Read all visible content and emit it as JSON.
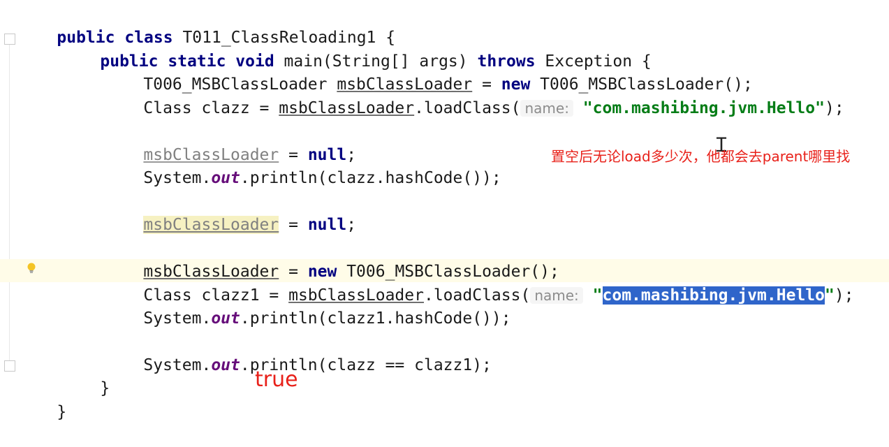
{
  "editor": {
    "code": {
      "l1_kw1": "public",
      "l1_kw2": "class",
      "l1_name": " T011_ClassReloading1 {",
      "l2_kw1": "public",
      "l2_kw2": "static",
      "l2_kw3": "void",
      "l2_mid": " main(String[] args) ",
      "l2_kw4": "throws",
      "l2_end": " Exception {",
      "l3_type": "T006_MSBClassLoader ",
      "l3_var": "msbClassLoader",
      "l3_eq": " = ",
      "l3_kw": "new",
      "l3_end": " T006_MSBClassLoader();",
      "l4_a": "Class clazz = ",
      "l4_var": "msbClassLoader",
      "l4_call": ".loadClass(",
      "l4_hint": "name:",
      "l4_str": "\"com.mashibing.jvm.Hello\"",
      "l4_end": ");",
      "l5_var": "msbClassLoader",
      "l5_eq": " = ",
      "l5_kw": "null",
      "l5_end": ";",
      "l6_a": "System.",
      "l6_field": "out",
      "l6_b": ".println(clazz.hashCode());",
      "l7_var": "msbClassLoader",
      "l7_eq": " = ",
      "l7_kw": "null",
      "l7_end": ";",
      "l8_var": "msbClassLoader",
      "l8_eq": " = ",
      "l8_kw": "new",
      "l8_end": " T006_MSBClassLoader();",
      "l9_a": "Class clazz1 = ",
      "l9_var": "msbClassLoader",
      "l9_call": ".loadClass(",
      "l9_hint": "name:",
      "l9_q1": "\"",
      "l9_sel": "com.mashibing.jvm.Hello",
      "l9_q2": "\"",
      "l9_end": ");",
      "l10_a": "System.",
      "l10_field": "out",
      "l10_b": ".println(clazz1.hashCode());",
      "l11_a": "System.",
      "l11_field": "out",
      "l11_b": ".println(clazz == clazz1);",
      "l12": "}",
      "l13": "}"
    },
    "annotations": {
      "note_null": "置空后无论load多少次，他都会去parent哪里找",
      "note_result": "true"
    },
    "icons": {
      "bulb": "lightbulb-icon",
      "cursor": "text-cursor-icon",
      "fold": "fold-marker-icon"
    },
    "colors": {
      "keyword": "#000080",
      "string": "#067d17",
      "static_field": "#660e7a",
      "selection": "#2f65ca",
      "annotation": "#e8211a"
    }
  }
}
